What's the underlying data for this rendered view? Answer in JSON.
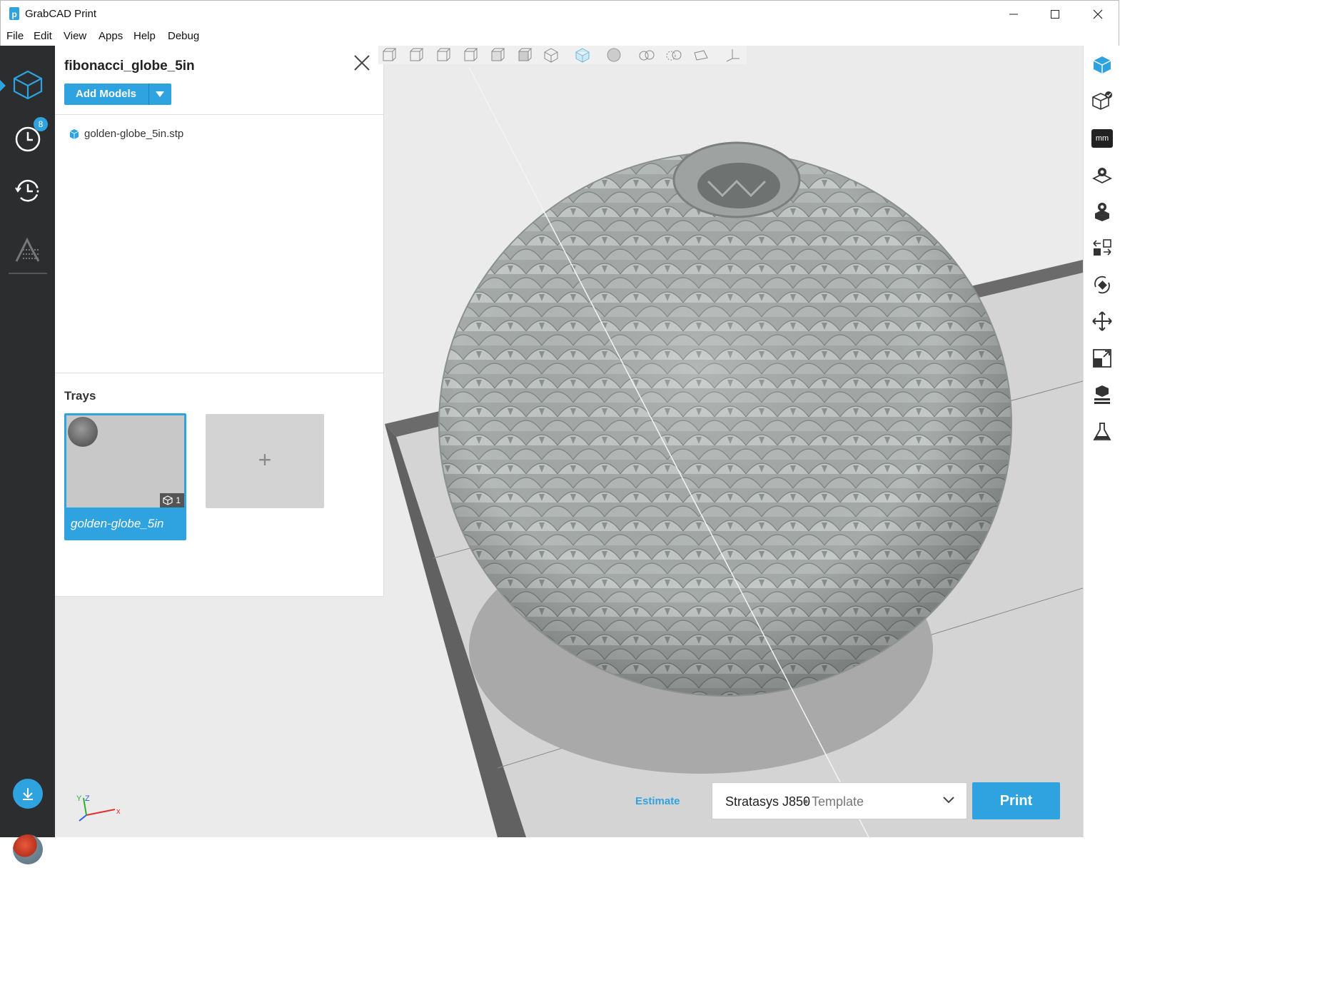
{
  "window": {
    "title": "GrabCAD Print",
    "controls": [
      "minimize",
      "maximize",
      "close"
    ]
  },
  "menu": [
    "File",
    "Edit",
    "View",
    "Apps",
    "Help",
    "Debug"
  ],
  "left_nav": {
    "items": [
      {
        "name": "project",
        "icon": "cube-icon",
        "active": true
      },
      {
        "name": "queue",
        "icon": "clock-icon",
        "badge": "8"
      },
      {
        "name": "history",
        "icon": "history-icon"
      },
      {
        "name": "printer",
        "icon": "printer-status-icon"
      }
    ],
    "download_icon": "download-icon",
    "avatar_icon": "user-avatar"
  },
  "panel": {
    "project_title": "fibonacci_globe_5in",
    "add_models_label": "Add Models",
    "models": [
      {
        "name": "golden-globe_5in.stp",
        "icon": "model-cube-icon"
      }
    ],
    "trays_label": "Trays",
    "trays": [
      {
        "name": "golden-globe_5in",
        "model_count": "1",
        "selected": true
      }
    ],
    "add_tray_label": "+"
  },
  "view_toolbar": [
    "view-front-icon",
    "view-back-icon",
    "view-left-icon",
    "view-right-icon",
    "view-top-icon",
    "view-bottom-icon",
    "view-iso-icon",
    "view-iso-active-icon",
    "shaded-icon",
    "model-display-icon",
    "wireframe-icon",
    "section-icon",
    "axes-icon"
  ],
  "right_toolbar": [
    "model-view-icon",
    "check-model-icon",
    "units-icon",
    "tray-settings-icon",
    "model-settings-icon",
    "arrange-icon",
    "rotate-icon",
    "move-icon",
    "scale-icon",
    "support-icon",
    "material-icon"
  ],
  "units_label": "mm",
  "bottom": {
    "estimate_label": "Estimate",
    "printer_name": "Stratasys J850",
    "printer_suffix": "• Template",
    "print_label": "Print"
  },
  "colors": {
    "accent": "#2fa3e0",
    "nav_bg": "#2b2d2f",
    "model_gray": "#9aa09e"
  }
}
